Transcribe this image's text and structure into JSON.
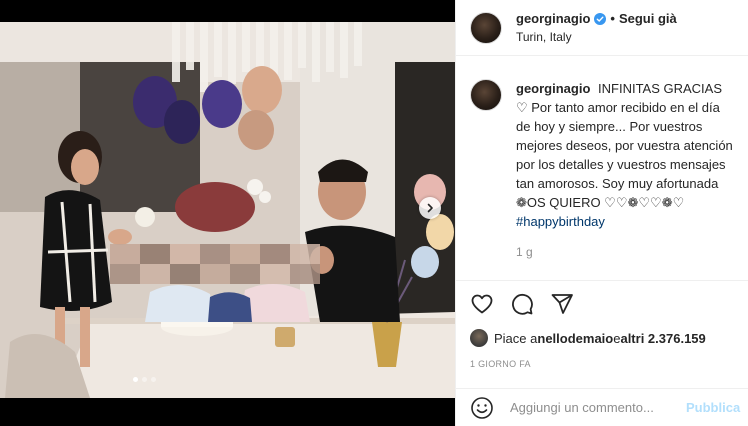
{
  "post": {
    "username": "georginagio",
    "follow_separator": "•",
    "follow_status": "Segui già",
    "location": "Turin, Italy",
    "caption_text": "INFINITAS GRACIAS ♡ Por tanto amor recibido en el día de hoy y siempre... Por vuestros mejores deseos, por vuestra atención por los detalles y vuestros mensajes tan amorosos. Soy muy afortunada ❁OS QUIERO ♡♡❁♡♡❁♡",
    "hashtag": "#happybirthday",
    "caption_age": "1 g",
    "likes_prefix": "Piace a ",
    "likes_user": "nellodemaio",
    "likes_middle": " e ",
    "likes_count": "altri 2.376.159",
    "date": "1 GIORNO FA",
    "comment_placeholder": "Aggiungi un commento...",
    "publish_label": "Pubblica"
  },
  "icons": {
    "verified": "verified-badge-icon",
    "like": "heart-icon",
    "comment": "comment-icon",
    "share": "share-icon",
    "emoji": "emoji-icon",
    "next": "chevron-right-icon"
  },
  "colors": {
    "verified": "#3897f0",
    "hashtag": "#00376b",
    "publish": "#b2dffc",
    "muted": "#8e8e8e"
  },
  "carousel": {
    "slides": 3,
    "active": 1
  }
}
